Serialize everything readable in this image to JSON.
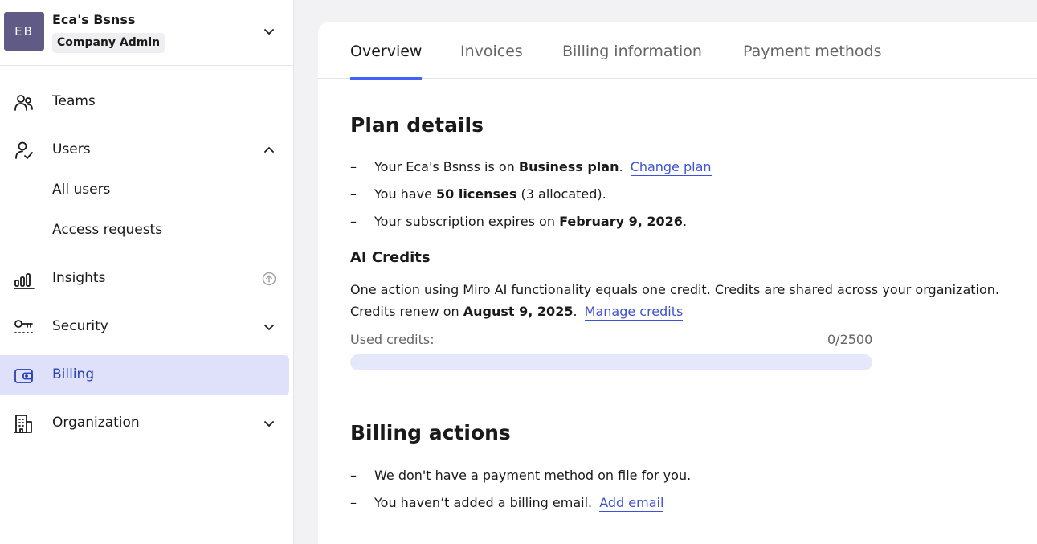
{
  "org": {
    "initials": "EB",
    "name": "Eca's Bsnss",
    "role": "Company Admin",
    "avatar_color": "#5f5b85"
  },
  "sidebar": {
    "items": [
      {
        "label": "Teams",
        "icon": "teams-icon"
      },
      {
        "label": "Users",
        "icon": "user-check-icon",
        "expanded": true
      },
      {
        "label": "All users"
      },
      {
        "label": "Access requests"
      },
      {
        "label": "Insights",
        "icon": "bar-chart-icon",
        "badge_icon": "upgrade-arrow-icon"
      },
      {
        "label": "Security",
        "icon": "key-icon"
      },
      {
        "label": "Billing",
        "icon": "wallet-icon",
        "active": true
      },
      {
        "label": "Organization",
        "icon": "building-icon"
      }
    ]
  },
  "tabs": [
    {
      "label": "Overview",
      "active": true
    },
    {
      "label": "Invoices"
    },
    {
      "label": "Billing information"
    },
    {
      "label": "Payment methods"
    }
  ],
  "plan": {
    "title": "Plan details",
    "line1_prefix": "Your Eca's Bsnss is on ",
    "line1_bold": "Business plan",
    "line1_suffix": ".",
    "change_plan_link": "Change plan",
    "line2_prefix": "You have ",
    "line2_bold": "50 licenses",
    "line2_suffix": " (3 allocated).",
    "line3_prefix": "Your subscription expires on ",
    "line3_bold": "February 9, 2026",
    "line3_suffix": "."
  },
  "ai_credits": {
    "title": "AI Credits",
    "description": "One action using Miro AI functionality equals one credit. Credits are shared across your organization.",
    "renew_prefix": "Credits renew on ",
    "renew_bold": "August 9, 2025",
    "renew_suffix": ".",
    "manage_link": "Manage credits",
    "used_label": "Used credits:",
    "used_value": "0/2500",
    "used_fraction": 0
  },
  "billing_actions": {
    "title": "Billing actions",
    "line1": "We don't have a payment method on file for you.",
    "line2": "You haven’t added a billing email.",
    "add_email_link": "Add email"
  },
  "colors": {
    "accent": "#4262ff",
    "link": "#3f51d8",
    "active_nav_bg": "#dfe1fb"
  }
}
